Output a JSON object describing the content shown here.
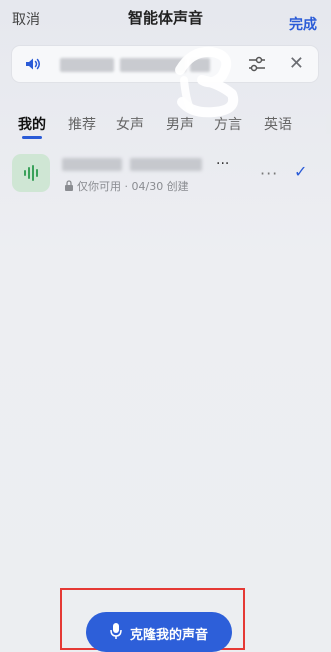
{
  "header": {
    "cancel_label": "取消",
    "title": "智能体声音",
    "done_label": "完成"
  },
  "tabs": [
    {
      "label": "我的",
      "active": true
    },
    {
      "label": "推荐",
      "active": false
    },
    {
      "label": "女声",
      "active": false
    },
    {
      "label": "男声",
      "active": false
    },
    {
      "label": "方言",
      "active": false
    },
    {
      "label": "英语",
      "active": false
    }
  ],
  "voice_item": {
    "name_suffix": "...",
    "meta": "仅你可用 · 04/30 创建",
    "selected": true
  },
  "bottom": {
    "clone_button_label": "克隆我的声音"
  },
  "colors": {
    "accent": "#2a5bd7",
    "button": "#2d5fd9",
    "highlight": "#e53935",
    "avatar_bg": "#cfe6d4",
    "avatar_fg": "#3aa15a"
  }
}
